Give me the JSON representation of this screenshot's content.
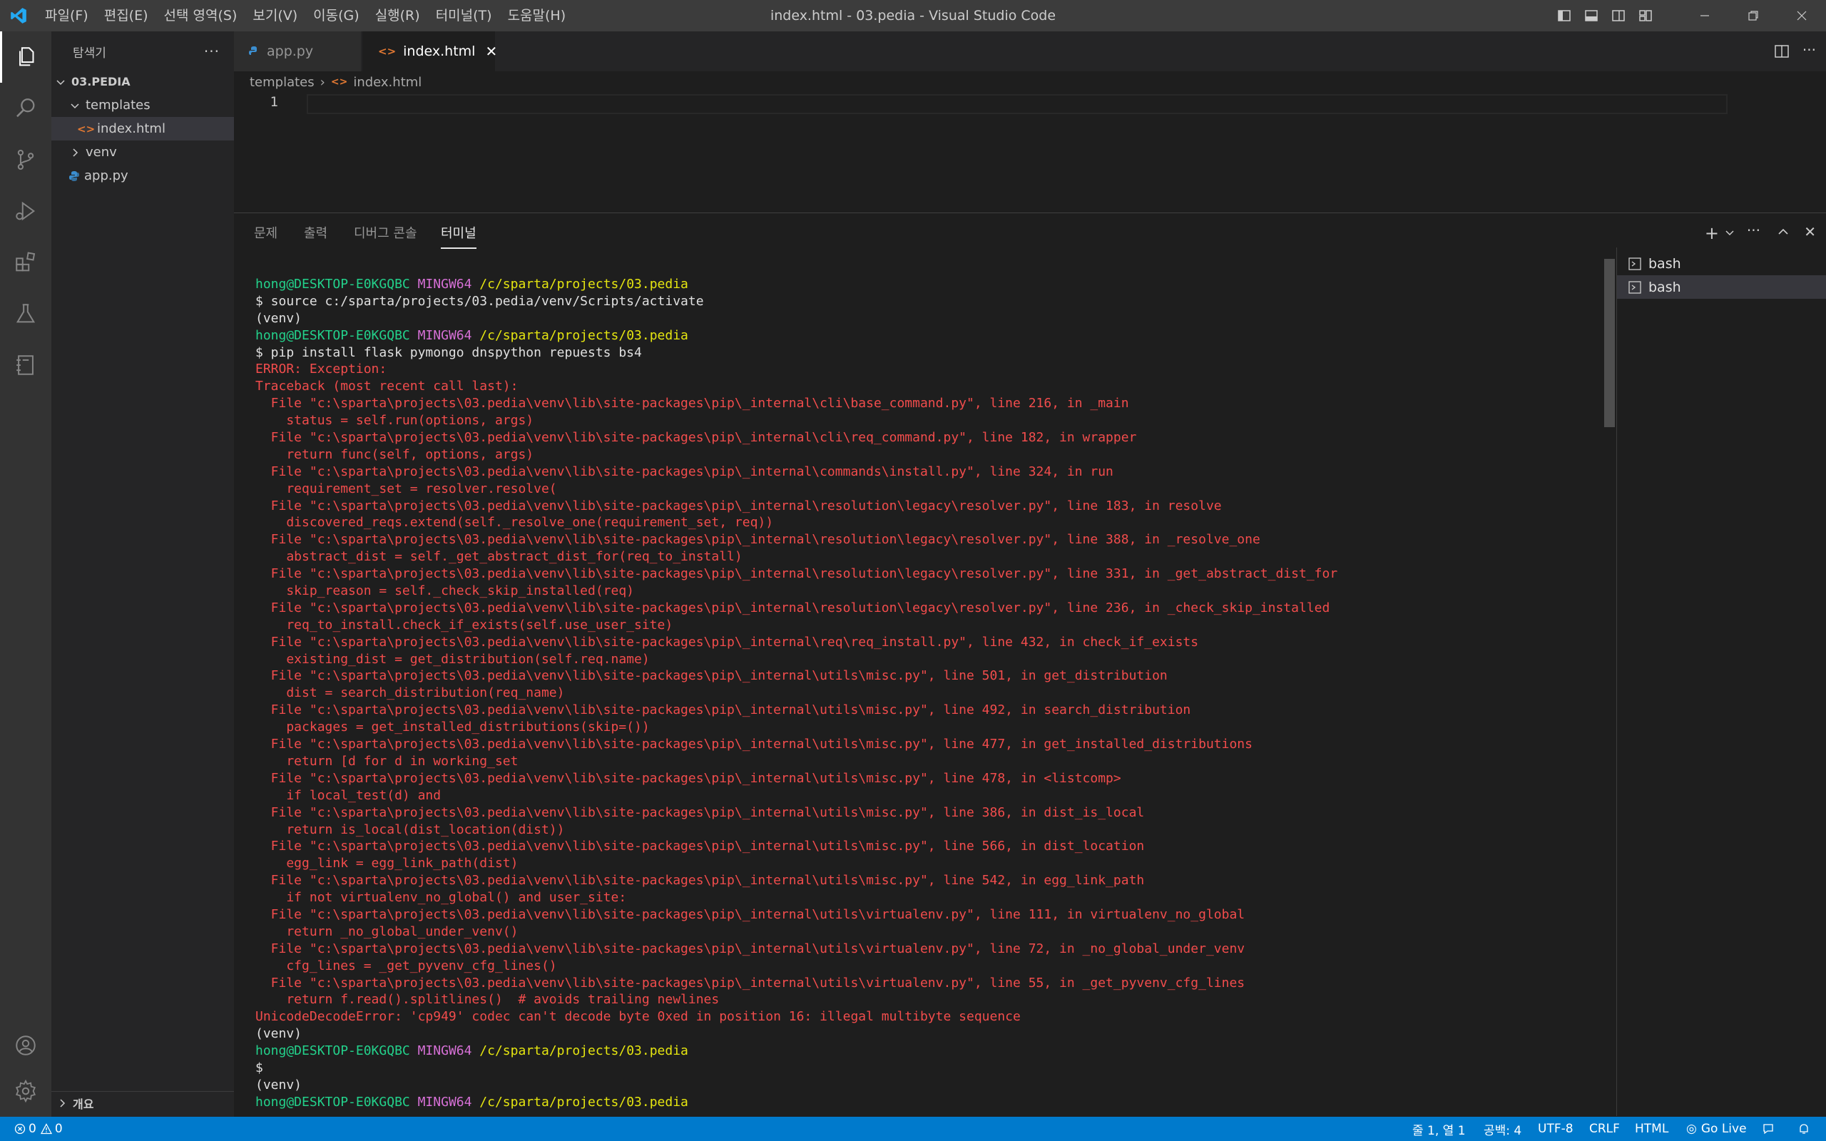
{
  "app": {
    "title": "index.html - 03.pedia - Visual Studio Code"
  },
  "menu": [
    "파일(F)",
    "편집(E)",
    "선택 영역(S)",
    "보기(V)",
    "이동(G)",
    "실행(R)",
    "터미널(T)",
    "도움말(H)"
  ],
  "sidebar": {
    "title": "탐색기",
    "folder": "03.PEDIA",
    "items": [
      {
        "label": "templates",
        "kind": "folder-open"
      },
      {
        "label": "index.html",
        "kind": "html",
        "selected": true
      },
      {
        "label": "venv",
        "kind": "folder"
      },
      {
        "label": "app.py",
        "kind": "python"
      }
    ],
    "outline": "개요"
  },
  "tabs": [
    {
      "label": "app.py",
      "active": false
    },
    {
      "label": "index.html",
      "active": true
    }
  ],
  "editor": {
    "breadcrumb": [
      "templates",
      "index.html"
    ],
    "line_numbers": [
      "1"
    ]
  },
  "panel": {
    "tabs": [
      "문제",
      "출력",
      "디버그 콘솔",
      "터미널"
    ],
    "active_tab": "터미널",
    "terminals": [
      "bash",
      "bash"
    ]
  },
  "terminal": {
    "user": "hong@DESKTOP-E0KGQBC",
    "host": "MINGW64",
    "path": "/c/sparta/projects/03.pedia",
    "lines": [
      {
        "t": "prompt"
      },
      {
        "t": "cmd",
        "text": "$ source c:/sparta/projects/03.pedia/venv/Scripts/activate"
      },
      {
        "t": "cmd",
        "text": "(venv)"
      },
      {
        "t": "prompt"
      },
      {
        "t": "cmd",
        "text": "$ pip install flask pymongo dnspython repuests bs4"
      },
      {
        "t": "err",
        "text": "ERROR: Exception:"
      },
      {
        "t": "err",
        "text": "Traceback (most recent call last):"
      },
      {
        "t": "err",
        "text": "  File \"c:\\sparta\\projects\\03.pedia\\venv\\lib\\site-packages\\pip\\_internal\\cli\\base_command.py\", line 216, in _main"
      },
      {
        "t": "err",
        "text": "    status = self.run(options, args)"
      },
      {
        "t": "err",
        "text": "  File \"c:\\sparta\\projects\\03.pedia\\venv\\lib\\site-packages\\pip\\_internal\\cli\\req_command.py\", line 182, in wrapper"
      },
      {
        "t": "err",
        "text": "    return func(self, options, args)"
      },
      {
        "t": "err",
        "text": "  File \"c:\\sparta\\projects\\03.pedia\\venv\\lib\\site-packages\\pip\\_internal\\commands\\install.py\", line 324, in run"
      },
      {
        "t": "err",
        "text": "    requirement_set = resolver.resolve("
      },
      {
        "t": "err",
        "text": "  File \"c:\\sparta\\projects\\03.pedia\\venv\\lib\\site-packages\\pip\\_internal\\resolution\\legacy\\resolver.py\", line 183, in resolve"
      },
      {
        "t": "err",
        "text": "    discovered_reqs.extend(self._resolve_one(requirement_set, req))"
      },
      {
        "t": "err",
        "text": "  File \"c:\\sparta\\projects\\03.pedia\\venv\\lib\\site-packages\\pip\\_internal\\resolution\\legacy\\resolver.py\", line 388, in _resolve_one"
      },
      {
        "t": "err",
        "text": "    abstract_dist = self._get_abstract_dist_for(req_to_install)"
      },
      {
        "t": "err",
        "text": "  File \"c:\\sparta\\projects\\03.pedia\\venv\\lib\\site-packages\\pip\\_internal\\resolution\\legacy\\resolver.py\", line 331, in _get_abstract_dist_for"
      },
      {
        "t": "err",
        "text": "    skip_reason = self._check_skip_installed(req)"
      },
      {
        "t": "err",
        "text": "  File \"c:\\sparta\\projects\\03.pedia\\venv\\lib\\site-packages\\pip\\_internal\\resolution\\legacy\\resolver.py\", line 236, in _check_skip_installed"
      },
      {
        "t": "err",
        "text": "    req_to_install.check_if_exists(self.use_user_site)"
      },
      {
        "t": "err",
        "text": "  File \"c:\\sparta\\projects\\03.pedia\\venv\\lib\\site-packages\\pip\\_internal\\req\\req_install.py\", line 432, in check_if_exists"
      },
      {
        "t": "err",
        "text": "    existing_dist = get_distribution(self.req.name)"
      },
      {
        "t": "err",
        "text": "  File \"c:\\sparta\\projects\\03.pedia\\venv\\lib\\site-packages\\pip\\_internal\\utils\\misc.py\", line 501, in get_distribution"
      },
      {
        "t": "err",
        "text": "    dist = search_distribution(req_name)"
      },
      {
        "t": "err",
        "text": "  File \"c:\\sparta\\projects\\03.pedia\\venv\\lib\\site-packages\\pip\\_internal\\utils\\misc.py\", line 492, in search_distribution"
      },
      {
        "t": "err",
        "text": "    packages = get_installed_distributions(skip=())"
      },
      {
        "t": "err",
        "text": "  File \"c:\\sparta\\projects\\03.pedia\\venv\\lib\\site-packages\\pip\\_internal\\utils\\misc.py\", line 477, in get_installed_distributions"
      },
      {
        "t": "err",
        "text": "    return [d for d in working_set"
      },
      {
        "t": "err",
        "text": "  File \"c:\\sparta\\projects\\03.pedia\\venv\\lib\\site-packages\\pip\\_internal\\utils\\misc.py\", line 478, in <listcomp>"
      },
      {
        "t": "err",
        "text": "    if local_test(d) and"
      },
      {
        "t": "err",
        "text": "  File \"c:\\sparta\\projects\\03.pedia\\venv\\lib\\site-packages\\pip\\_internal\\utils\\misc.py\", line 386, in dist_is_local"
      },
      {
        "t": "err",
        "text": "    return is_local(dist_location(dist))"
      },
      {
        "t": "err",
        "text": "  File \"c:\\sparta\\projects\\03.pedia\\venv\\lib\\site-packages\\pip\\_internal\\utils\\misc.py\", line 566, in dist_location"
      },
      {
        "t": "err",
        "text": "    egg_link = egg_link_path(dist)"
      },
      {
        "t": "err",
        "text": "  File \"c:\\sparta\\projects\\03.pedia\\venv\\lib\\site-packages\\pip\\_internal\\utils\\misc.py\", line 542, in egg_link_path"
      },
      {
        "t": "err",
        "text": "    if not virtualenv_no_global() and user_site:"
      },
      {
        "t": "err",
        "text": "  File \"c:\\sparta\\projects\\03.pedia\\venv\\lib\\site-packages\\pip\\_internal\\utils\\virtualenv.py\", line 111, in virtualenv_no_global"
      },
      {
        "t": "err",
        "text": "    return _no_global_under_venv()"
      },
      {
        "t": "err",
        "text": "  File \"c:\\sparta\\projects\\03.pedia\\venv\\lib\\site-packages\\pip\\_internal\\utils\\virtualenv.py\", line 72, in _no_global_under_venv"
      },
      {
        "t": "err",
        "text": "    cfg_lines = _get_pyvenv_cfg_lines()"
      },
      {
        "t": "err",
        "text": "  File \"c:\\sparta\\projects\\03.pedia\\venv\\lib\\site-packages\\pip\\_internal\\utils\\virtualenv.py\", line 55, in _get_pyvenv_cfg_lines"
      },
      {
        "t": "err",
        "text": "    return f.read().splitlines()  # avoids trailing newlines"
      },
      {
        "t": "err",
        "text": "UnicodeDecodeError: 'cp949' codec can't decode byte 0xed in position 16: illegal multibyte sequence"
      },
      {
        "t": "cmd",
        "text": "(venv)"
      },
      {
        "t": "prompt"
      },
      {
        "t": "cmd",
        "text": "$"
      },
      {
        "t": "cmd",
        "text": "(venv)"
      },
      {
        "t": "prompt"
      }
    ]
  },
  "status": {
    "errors": "0",
    "warnings": "0",
    "position": "줄 1, 열 1",
    "spaces": "공백: 4",
    "encoding": "UTF-8",
    "eol": "CRLF",
    "language": "HTML",
    "golive": "Go Live"
  }
}
